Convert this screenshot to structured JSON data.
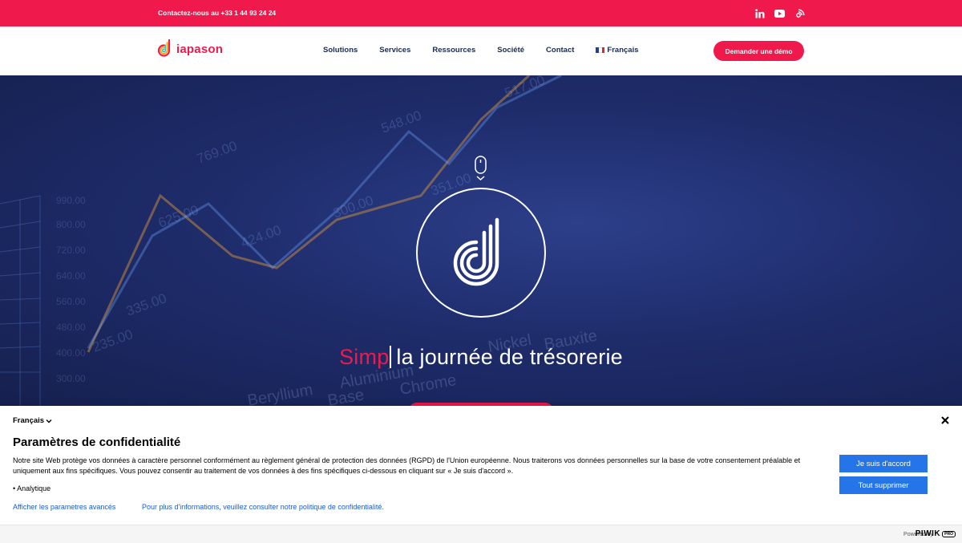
{
  "topbar": {
    "contact_text": "Contactez-nous au +33 1 44 93 24 24",
    "socials": [
      "linkedin-icon",
      "youtube-icon",
      "podcast-icon"
    ],
    "bg_color": "#f0194b"
  },
  "nav": {
    "logo_text": "iapason",
    "menu": [
      "Solutions",
      "Services",
      "Ressources",
      "Société",
      "Contact"
    ],
    "language": "Français",
    "demo_button": "Demander une démo"
  },
  "hero": {
    "title_accent": "Simp",
    "title_rest": "la journée de trésorerie",
    "bg_numbers": [
      "517.00",
      "548.00",
      "769.00",
      "625.00",
      "424.00",
      "300.00",
      "351.00",
      "335.00",
      "235.00",
      "990.00",
      "800.00",
      "720.00",
      "640.00",
      "560.00",
      "480.00",
      "400.00",
      "300.00"
    ],
    "bg_words": [
      "Nickel",
      "Bauxite",
      "Aluminium",
      "Chrome",
      "Beryllium",
      "Base"
    ]
  },
  "consent": {
    "language": "Français",
    "title": "Paramètres de confidentialité",
    "description": "Notre site Web protège vos données à caractère personnel conformément au règlement général de protection des données (RGPD) de l'Union européenne. Nous traiterons vos données personnelles sur la base de votre consentement préalable et uniquement aux fins spécifiques. Vous pouvez consentir au traitement de vos données à des fins spécifiques ci-dessous en cliquant sur « Je suis d'accord ».",
    "bullet": "• Analytique",
    "link_advanced": "Afficher les parametres avancés",
    "link_policy": "Pour plus d'informations, veuillez consulter notre politique de confidentialité.",
    "agree_button": "Je suis d'accord",
    "delete_button": "Tout supprimer",
    "powered_by": "Powered by",
    "piwik_word": "PIWIK",
    "piwik_pro": "PRO"
  }
}
